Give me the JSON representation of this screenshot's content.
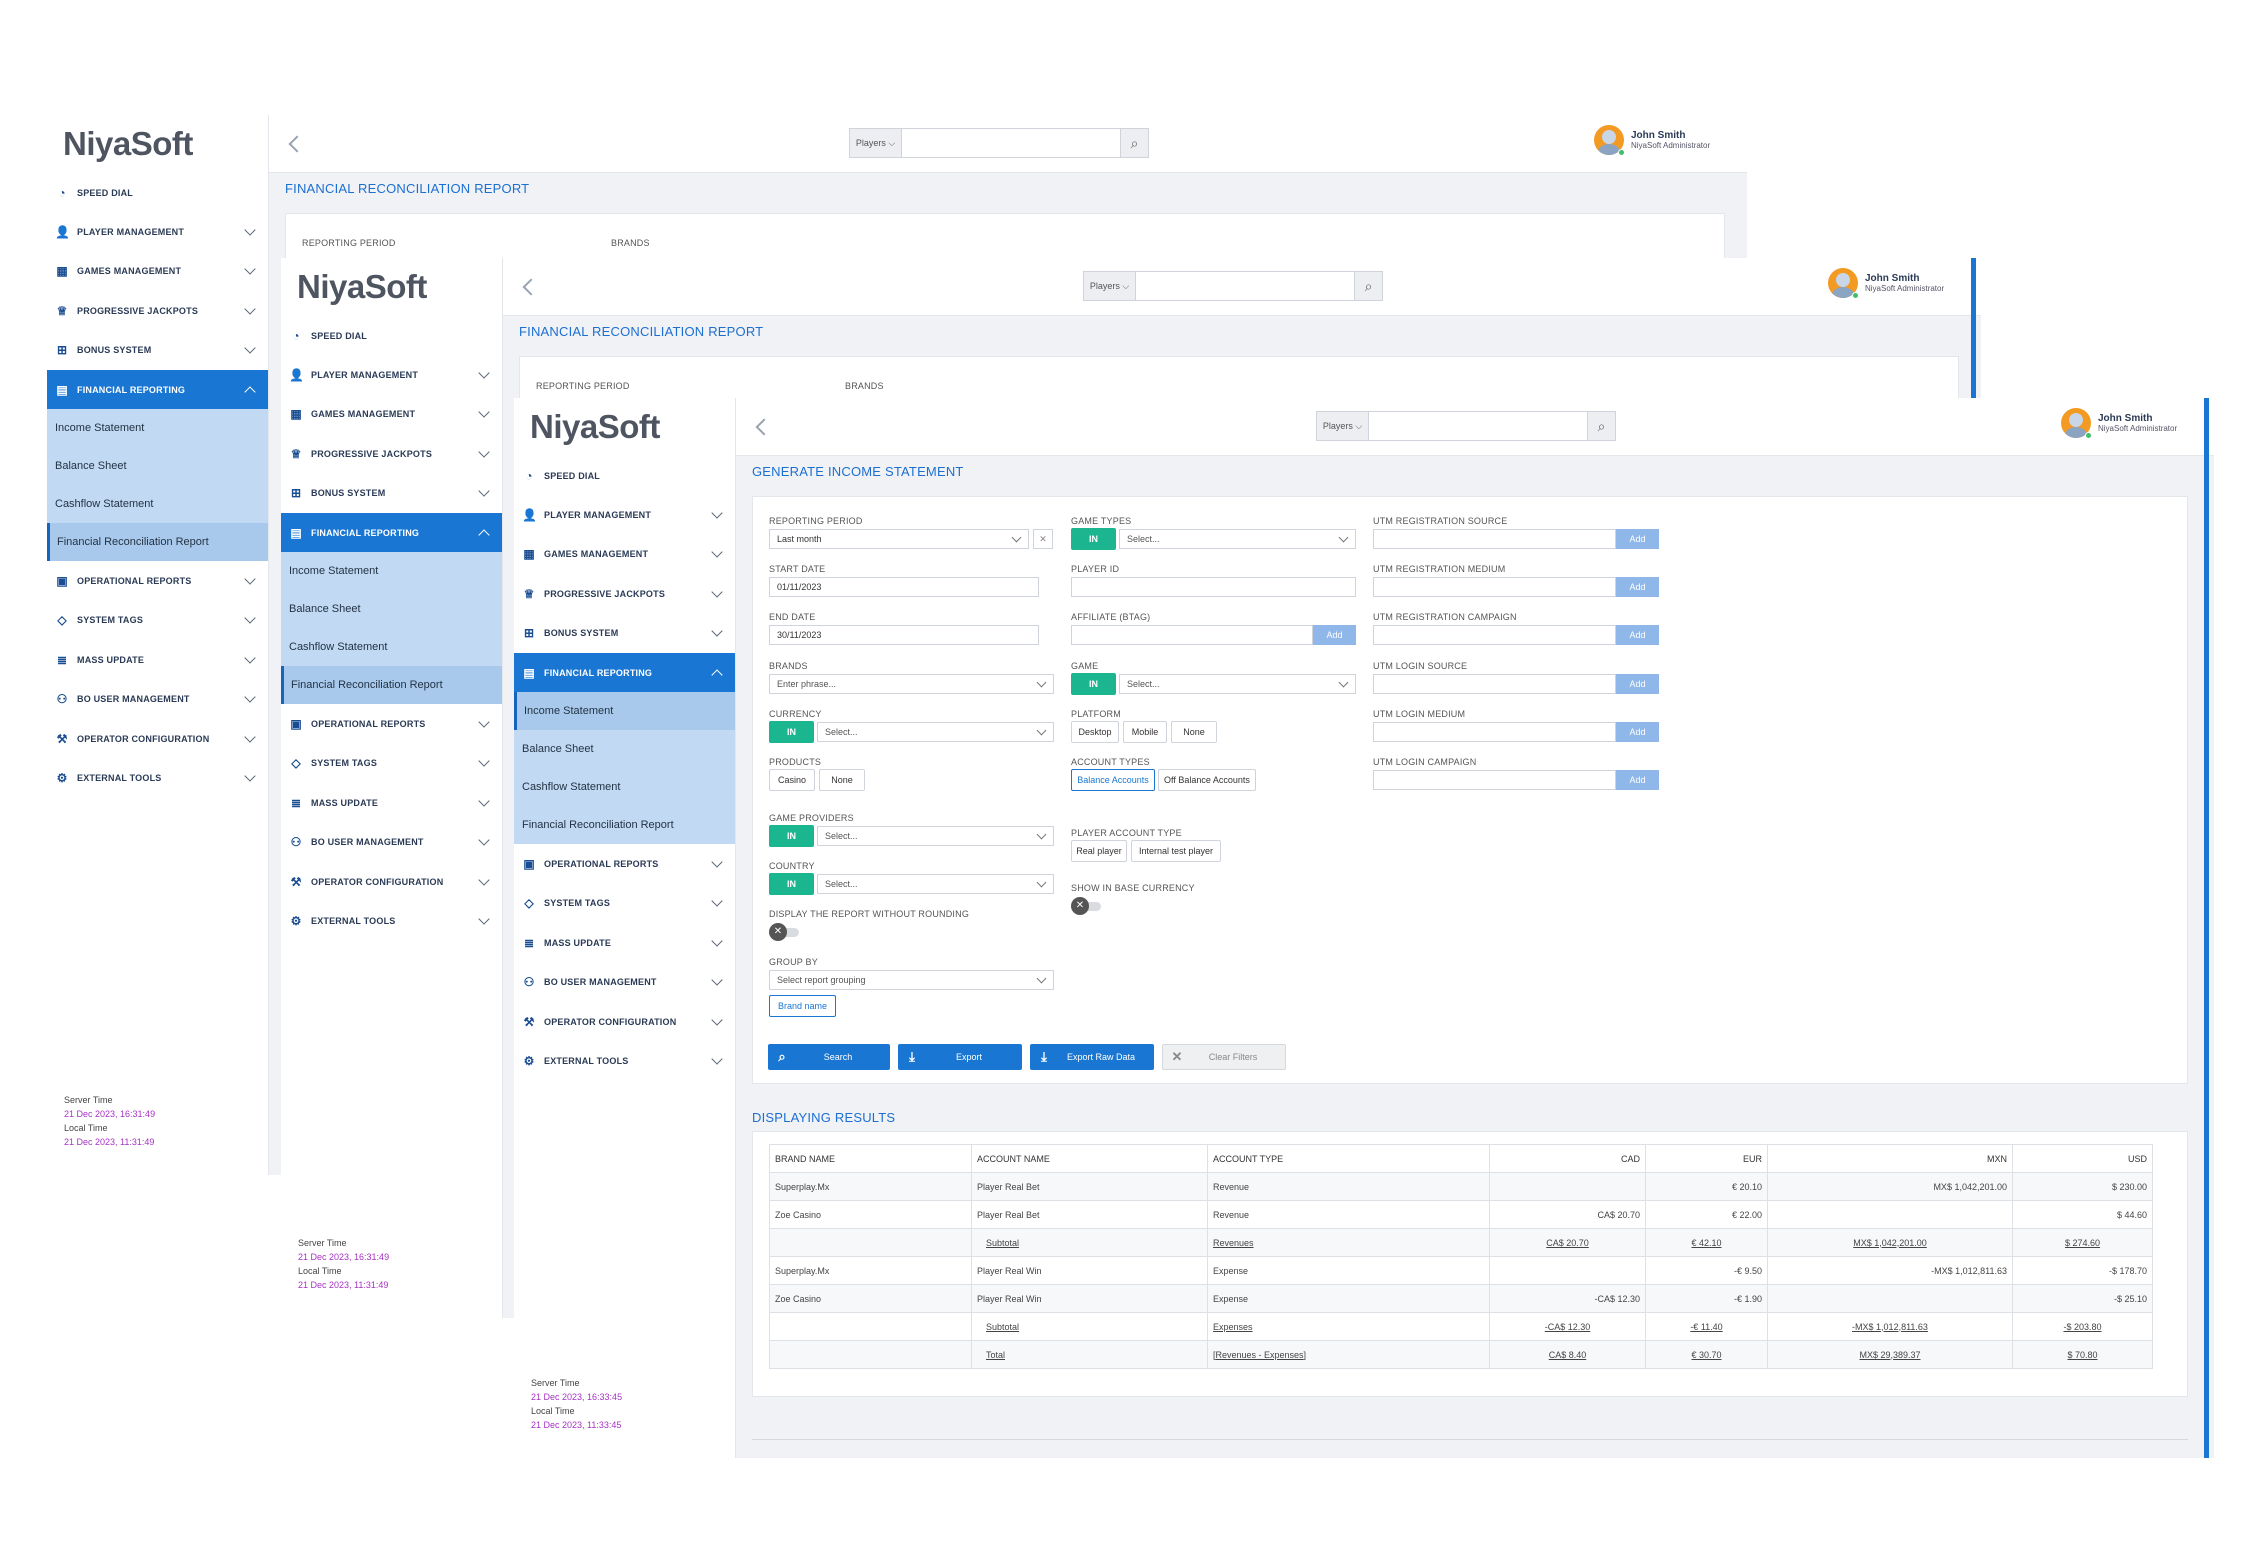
{
  "app": {
    "logo": "NiyaSoft",
    "accent": "#1976d2",
    "success": "#1bb58f"
  },
  "nav": {
    "items": [
      {
        "label": "SPEED DIAL",
        "icon": "speedometer-icon"
      },
      {
        "label": "PLAYER MANAGEMENT",
        "icon": "user-icon"
      },
      {
        "label": "GAMES MANAGEMENT",
        "icon": "grid-icon"
      },
      {
        "label": "PROGRESSIVE JACKPOTS",
        "icon": "trophy-icon"
      },
      {
        "label": "BONUS SYSTEM",
        "icon": "gift-icon"
      },
      {
        "label": "FINANCIAL REPORTING",
        "icon": "document-icon"
      },
      {
        "label": "OPERATIONAL REPORTS",
        "icon": "report-icon"
      },
      {
        "label": "SYSTEM TAGS",
        "icon": "tag-icon"
      },
      {
        "label": "MASS UPDATE",
        "icon": "stack-icon"
      },
      {
        "label": "BO USER MANAGEMENT",
        "icon": "users-icon"
      },
      {
        "label": "OPERATOR CONFIGURATION",
        "icon": "wrench-icon"
      },
      {
        "label": "EXTERNAL TOOLS",
        "icon": "gear-icon"
      }
    ],
    "sub": [
      "Income Statement",
      "Balance Sheet",
      "Cashflow Statement",
      "Financial Reconciliation Report"
    ]
  },
  "server": {
    "server_label": "Server Time",
    "local_label": "Local Time",
    "w1_server": "21 Dec 2023, 16:31:49",
    "w1_local": "21 Dec 2023, 11:31:49",
    "w3_server": "21 Dec 2023, 16:33:45",
    "w3_local": "21 Dec 2023, 11:33:45"
  },
  "search": {
    "scope": "Players ⌵",
    "icon": "search-icon"
  },
  "user": {
    "name": "John Smith",
    "role": "NiyaSoft Administrator"
  },
  "page": {
    "reconciliation_title": "FINANCIAL RECONCILIATION REPORT",
    "reporting_period": "REPORTING PERIOD",
    "brands": "BRANDS",
    "income_title": "GENERATE INCOME STATEMENT",
    "results_title": "DISPLAYING RESULTS"
  },
  "form": {
    "reporting_period": {
      "label": "REPORTING PERIOD",
      "value": "Last month"
    },
    "start_date": {
      "label": "START DATE",
      "value": "01/11/2023"
    },
    "end_date": {
      "label": "END DATE",
      "value": "30/11/2023"
    },
    "brands": {
      "label": "BRANDS",
      "placeholder": "Enter phrase..."
    },
    "currency": {
      "label": "CURRENCY",
      "placeholder": "Select..."
    },
    "products": {
      "label": "PRODUCTS",
      "options": [
        "Casino",
        "None"
      ]
    },
    "game_providers": {
      "label": "GAME PROVIDERS",
      "placeholder": "Select..."
    },
    "country": {
      "label": "COUNTRY",
      "placeholder": "Select..."
    },
    "no_rounding": {
      "label": "DISPLAY THE REPORT WITHOUT ROUNDING"
    },
    "group_by": {
      "label": "GROUP BY",
      "placeholder": "Select report grouping",
      "chip": "Brand name"
    },
    "game_types": {
      "label": "GAME TYPES",
      "placeholder": "Select..."
    },
    "player_id": {
      "label": "PLAYER ID"
    },
    "affiliate": {
      "label": "AFFILIATE (BTAG)"
    },
    "game": {
      "label": "GAME",
      "placeholder": "Select..."
    },
    "platform": {
      "label": "PLATFORM",
      "options": [
        "Desktop",
        "Mobile",
        "None"
      ]
    },
    "account_types": {
      "label": "ACCOUNT TYPES",
      "options": [
        "Balance Accounts",
        "Off Balance Accounts"
      ]
    },
    "player_account_type": {
      "label": "PLAYER ACCOUNT TYPE",
      "options": [
        "Real player",
        "Internal test player"
      ]
    },
    "base_currency": {
      "label": "SHOW IN BASE CURRENCY"
    },
    "utm": [
      "UTM REGISTRATION SOURCE",
      "UTM REGISTRATION MEDIUM",
      "UTM REGISTRATION CAMPAIGN",
      "UTM LOGIN SOURCE",
      "UTM LOGIN MEDIUM",
      "UTM LOGIN CAMPAIGN"
    ],
    "in_label": "IN",
    "add_label": "Add"
  },
  "actions": {
    "search": "Search",
    "export": "Export",
    "export_raw": "Export Raw Data",
    "clear": "Clear Filters"
  },
  "table": {
    "headers": [
      "BRAND NAME",
      "ACCOUNT NAME",
      "ACCOUNT TYPE",
      "CAD",
      "EUR",
      "MXN",
      "USD"
    ],
    "rows": [
      [
        "Superplay.Mx",
        "Player Real Bet",
        "Revenue",
        "",
        "€ 20.10",
        "MX$ 1,042,201.00",
        "$ 230.00"
      ],
      [
        "Zoe Casino",
        "Player Real Bet",
        "Revenue",
        "CA$ 20.70",
        "€ 22.00",
        "",
        "$ 44.60"
      ],
      [
        "",
        "Subtotal",
        "Revenues",
        "CA$ 20.70",
        "€ 42.10",
        "MX$ 1,042,201.00",
        "$ 274.60"
      ],
      [
        "Superplay.Mx",
        "Player Real Win",
        "Expense",
        "",
        "-€ 9.50",
        "-MX$ 1,012,811.63",
        "-$ 178.70"
      ],
      [
        "Zoe Casino",
        "Player Real Win",
        "Expense",
        "-CA$ 12.30",
        "-€ 1.90",
        "",
        "-$ 25.10"
      ],
      [
        "",
        "Subtotal",
        "Expenses",
        "-CA$ 12.30",
        "-€ 11.40",
        "-MX$ 1,012,811.63",
        "-$ 203.80"
      ],
      [
        "",
        "Total",
        "[Revenues - Expenses]",
        "CA$ 8.40",
        "€ 30.70",
        "MX$ 29,389.37",
        "$ 70.80"
      ]
    ]
  }
}
